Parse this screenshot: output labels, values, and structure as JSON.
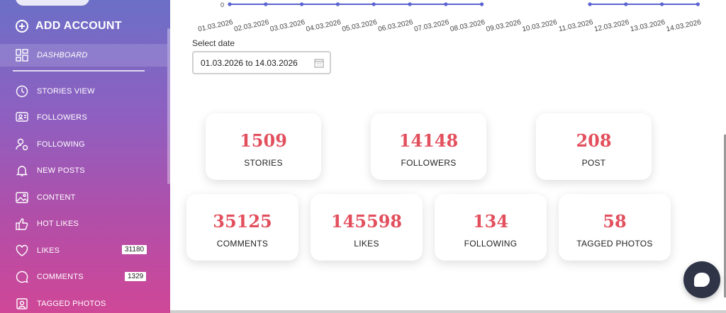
{
  "sidebar": {
    "add_account": "ADD ACCOUNT",
    "dashboard": "DASHBOARD",
    "items": [
      {
        "label": "STORIES VIEW",
        "icon": "clock-icon"
      },
      {
        "label": "FOLLOWERS",
        "icon": "followers-icon"
      },
      {
        "label": "FOLLOWING",
        "icon": "following-icon"
      },
      {
        "label": "NEW POSTS",
        "icon": "bell-icon"
      },
      {
        "label": "CONTENT",
        "icon": "image-icon"
      },
      {
        "label": "HOT LIKES",
        "icon": "thumbs-up-icon"
      },
      {
        "label": "LIKES",
        "icon": "heart-icon",
        "badge": "31180"
      },
      {
        "label": "COMMENTS",
        "icon": "comment-icon",
        "badge": "1329"
      },
      {
        "label": "TAGGED PHOTOS",
        "icon": "tag-photo-icon"
      }
    ]
  },
  "chart": {
    "y_tick": "0",
    "dates": [
      "01.03.2026",
      "02.03.2026",
      "03.03.2026",
      "04.03.2026",
      "05.03.2026",
      "06.03.2026",
      "07.03.2026",
      "08.03.2026",
      "09.03.2026",
      "10.03.2026",
      "11.03.2026",
      "12.03.2026",
      "13.03.2026",
      "14.03.2026"
    ],
    "line_color": "#5b63d1"
  },
  "date_filter": {
    "label": "Select date",
    "value": "01.03.2026 to 14.03.2026"
  },
  "stats": [
    {
      "value": "1509",
      "label": "STORIES"
    },
    {
      "value": "14148",
      "label": "FOLLOWERS"
    },
    {
      "value": "208",
      "label": "POST"
    },
    {
      "value": "35125",
      "label": "COMMENTS"
    },
    {
      "value": "145598",
      "label": "LIKES"
    },
    {
      "value": "134",
      "label": "FOLLOWING"
    },
    {
      "value": "58",
      "label": "TAGGED PHOTOS"
    }
  ],
  "colors": {
    "accent": "#e2505e",
    "chat": "#2f3447"
  }
}
